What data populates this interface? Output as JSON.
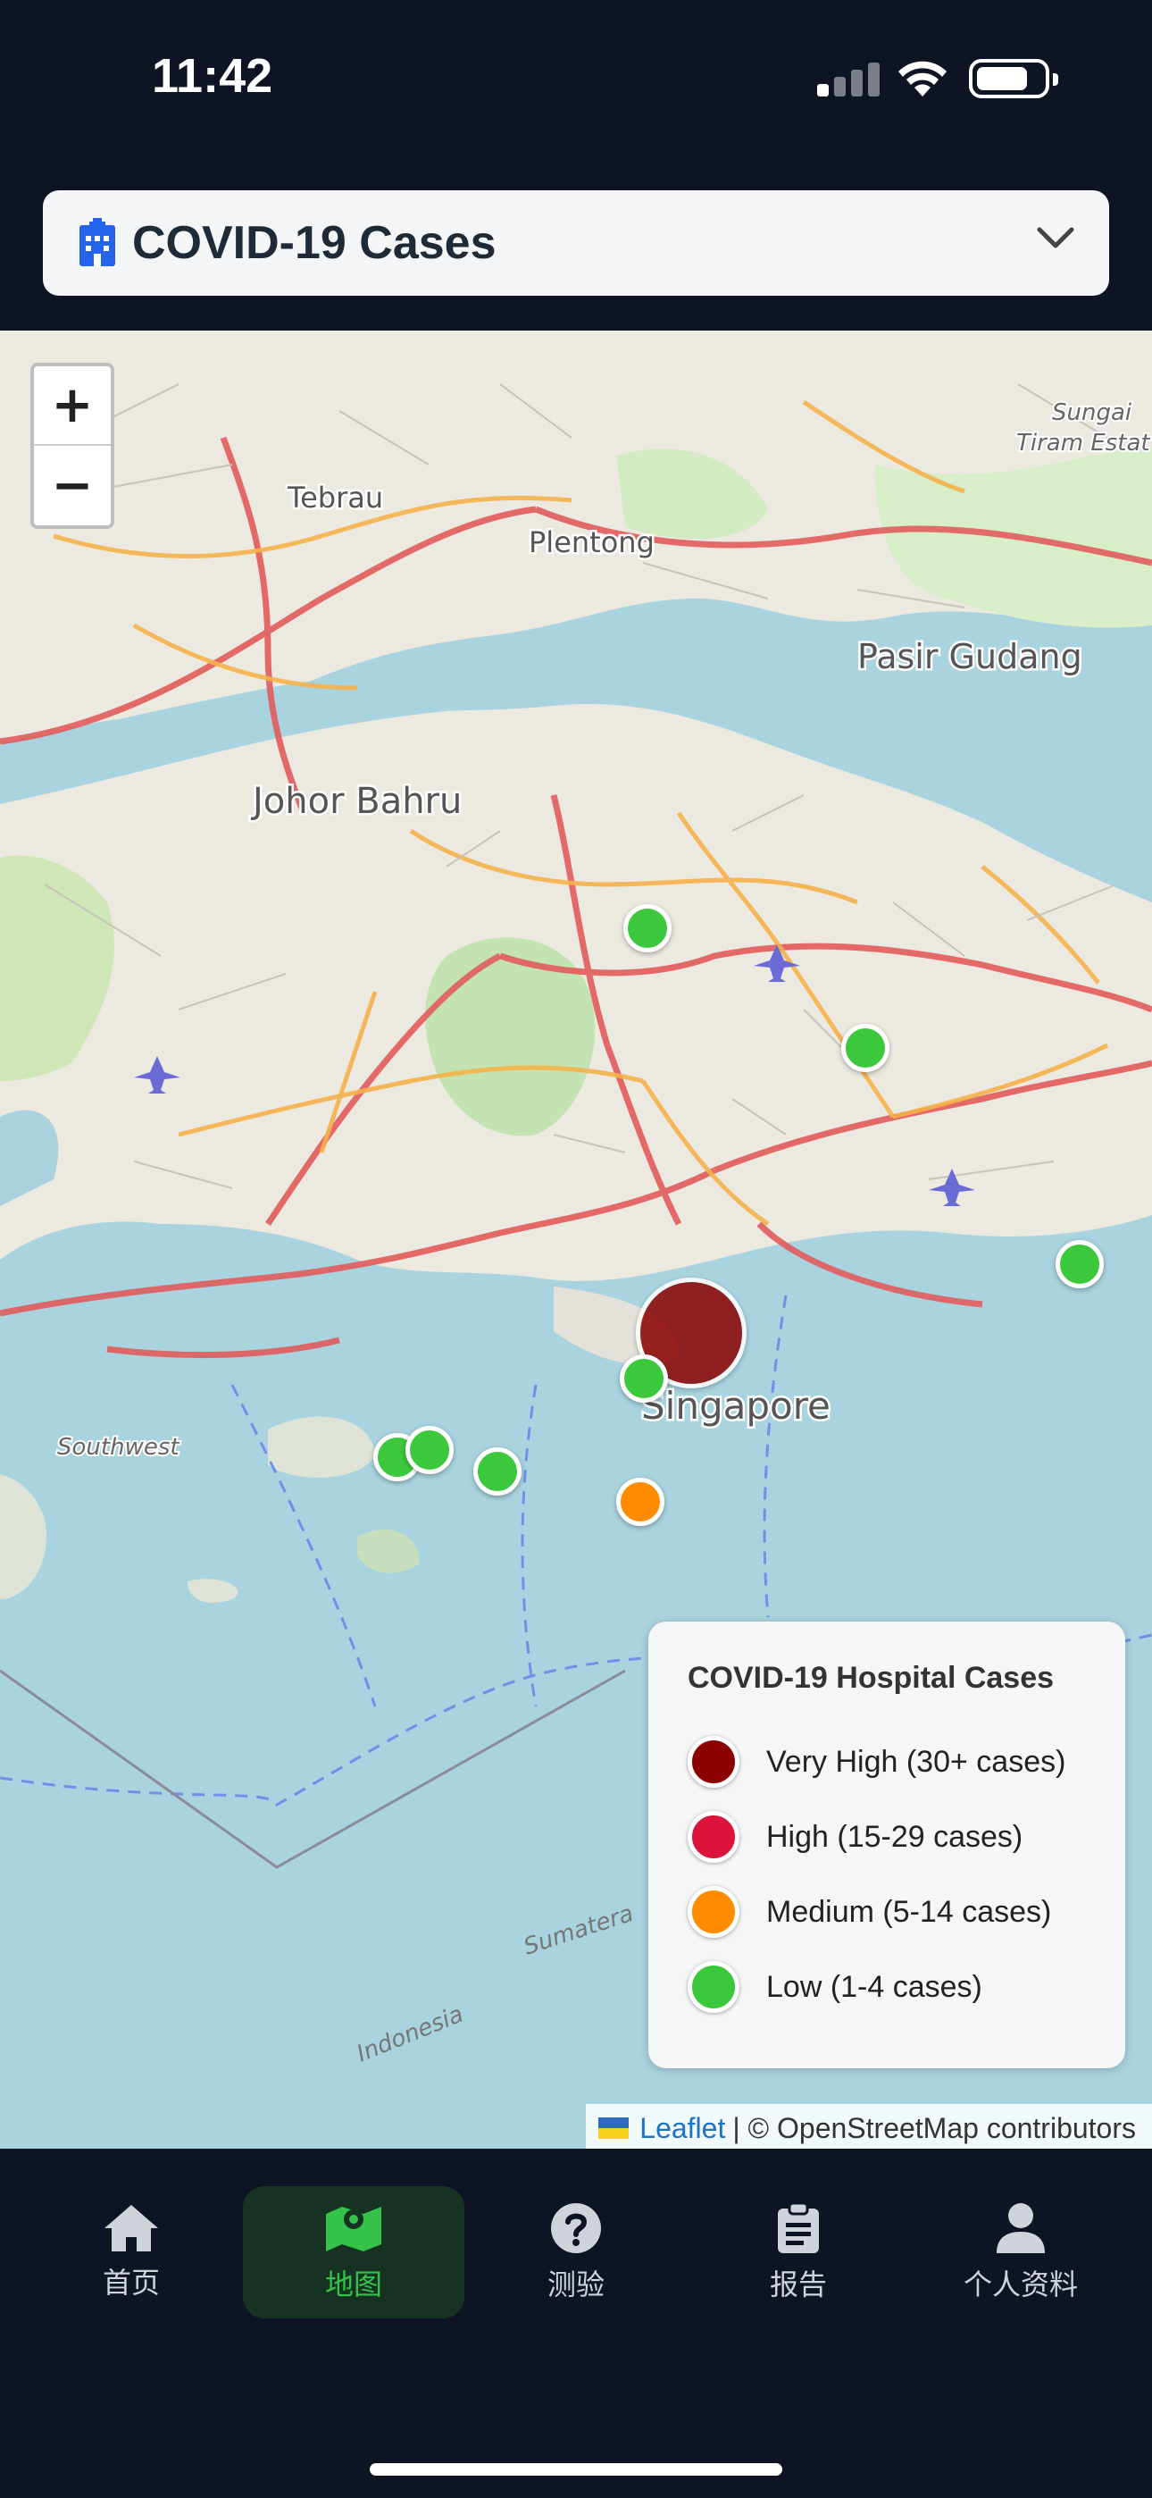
{
  "status": {
    "time": "11:42"
  },
  "header": {
    "title": "COVID-19 Cases",
    "title_icon": "hospital-icon",
    "dropdown_icon": "chevron-down-icon"
  },
  "map": {
    "zoom_in": "+",
    "zoom_out": "−",
    "place_labels": {
      "johor_bahru": "Johor Bahru",
      "singapore": "Singapore",
      "pasir_gudang": "Pasir Gudang",
      "plentong": "Plentong",
      "tebrau": "Tebrau",
      "sungai": "Sungai",
      "tiram": "Tiram Estat",
      "southwest": "Southwest",
      "sumatera": "Sumatera",
      "indonesia": "Indonesia"
    },
    "attribution": {
      "leaflet": "Leaflet",
      "osm": "| © OpenStreetMap contributors"
    }
  },
  "markers": [
    {
      "level": "very_high",
      "color": "#8b0000"
    },
    {
      "level": "low",
      "color": "#3cc83c"
    },
    {
      "level": "low",
      "color": "#3cc83c"
    },
    {
      "level": "low",
      "color": "#3cc83c"
    },
    {
      "level": "low",
      "color": "#3cc83c"
    },
    {
      "level": "low",
      "color": "#3cc83c"
    },
    {
      "level": "low",
      "color": "#3cc83c"
    },
    {
      "level": "low",
      "color": "#3cc83c"
    },
    {
      "level": "medium",
      "color": "#ff8c00"
    }
  ],
  "legend": {
    "title": "COVID-19 Hospital Cases",
    "items": [
      {
        "label": "Very High (30+ cases)",
        "color": "#8b0000"
      },
      {
        "label": "High (15-29 cases)",
        "color": "#dc143c"
      },
      {
        "label": "Medium (5-14 cases)",
        "color": "#ff8c00"
      },
      {
        "label": "Low (1-4 cases)",
        "color": "#3cc83c"
      }
    ]
  },
  "tabs": [
    {
      "label": "首页",
      "icon": "home-icon"
    },
    {
      "label": "地图",
      "icon": "map-icon",
      "active": true
    },
    {
      "label": "测验",
      "icon": "question-icon"
    },
    {
      "label": "报告",
      "icon": "clipboard-icon"
    },
    {
      "label": "个人资料",
      "icon": "user-icon"
    }
  ],
  "colors": {
    "bar_bg": "#0e1424",
    "active_tab": "#34c24a",
    "water": "#a9d3df"
  }
}
